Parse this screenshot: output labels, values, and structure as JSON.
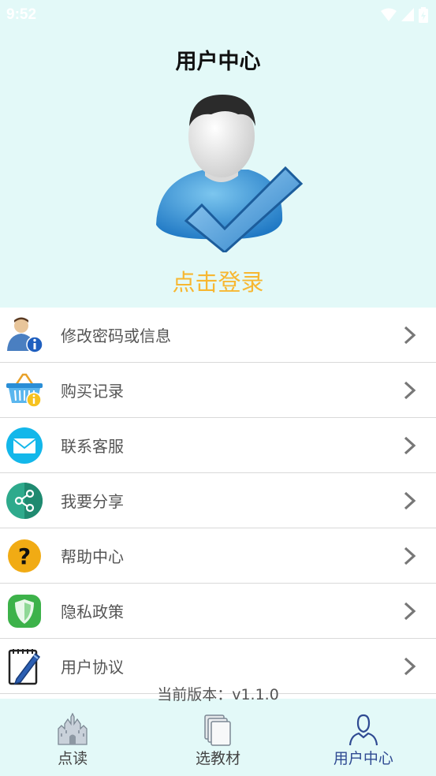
{
  "status": {
    "time": "9:52"
  },
  "header": {
    "title": "用户中心"
  },
  "profile": {
    "login_label": "点击登录"
  },
  "menu": {
    "items": [
      {
        "label": "修改密码或信息",
        "icon": "user-info-icon"
      },
      {
        "label": "购买记录",
        "icon": "basket-icon"
      },
      {
        "label": "联系客服",
        "icon": "mail-icon"
      },
      {
        "label": "我要分享",
        "icon": "share-icon"
      },
      {
        "label": "帮助中心",
        "icon": "help-icon"
      },
      {
        "label": "隐私政策",
        "icon": "shield-icon"
      },
      {
        "label": "用户协议",
        "icon": "notebook-pen-icon"
      }
    ]
  },
  "footer": {
    "version": "当前版本：v1.1.0"
  },
  "tabs": [
    {
      "label": "点读",
      "icon": "castle-icon",
      "active": false
    },
    {
      "label": "选教材",
      "icon": "books-icon",
      "active": false
    },
    {
      "label": "用户中心",
      "icon": "user-outline-icon",
      "active": true
    }
  ],
  "colors": {
    "background": "#e3f9f8",
    "login": "#f7b731",
    "active_tab": "#2f4a92"
  }
}
